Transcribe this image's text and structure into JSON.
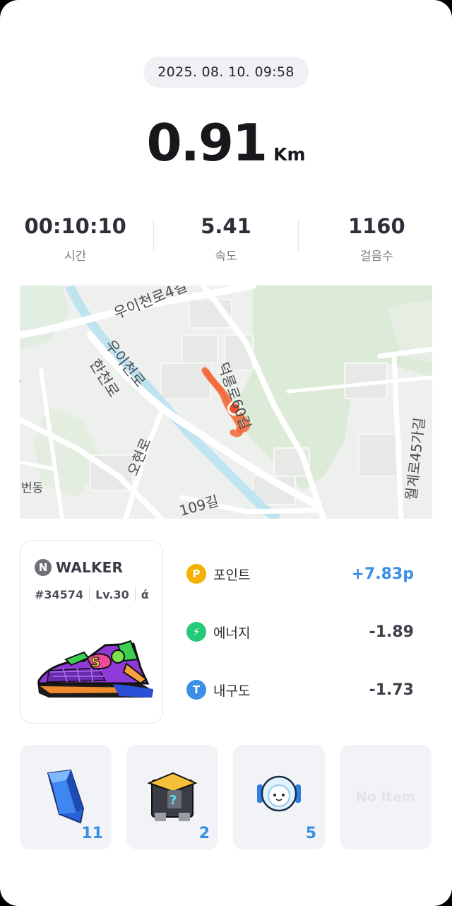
{
  "header": {
    "datetime": "2025. 08. 10. 09:58"
  },
  "distance": {
    "value": "0.91",
    "unit": "Km"
  },
  "stats": [
    {
      "value": "00:10:10",
      "label": "시간"
    },
    {
      "value": "5.41",
      "label": "속도"
    },
    {
      "value": "1160",
      "label": "걸음수"
    }
  ],
  "map": {
    "labels": {
      "road1": "우이천로4길",
      "road2": "우이천로",
      "road3": "한천로",
      "road4": "덕릉로60길",
      "road5": "오현로",
      "road6": "109길",
      "road7": "월계로45가길",
      "road8": "번동",
      "road9": "길"
    },
    "route_color": "#f36b3c",
    "marker_color": "#f0512e"
  },
  "sneaker": {
    "brand_letter": "N",
    "brand": "WALKER",
    "id": "#34574",
    "level": "Lv.30",
    "symbol": "ά"
  },
  "rewards": [
    {
      "icon": "point-icon",
      "icon_text": "P",
      "label": "포인트",
      "value": "+7.83p",
      "color": "#f5b100"
    },
    {
      "icon": "energy-icon",
      "icon_text": "⚡",
      "label": "에너지",
      "value": "-1.89",
      "color": "#25c97a"
    },
    {
      "icon": "durability-icon",
      "icon_text": "T",
      "label": "내구도",
      "value": "-1.73",
      "color": "#3c8ee6"
    }
  ],
  "items": [
    {
      "name": "blue-crystal-icon",
      "count": "11"
    },
    {
      "name": "mystery-box-icon",
      "count": "2"
    },
    {
      "name": "robot-helmet-icon",
      "count": "5"
    },
    {
      "name": "empty-slot",
      "empty_label": "No Item"
    }
  ]
}
